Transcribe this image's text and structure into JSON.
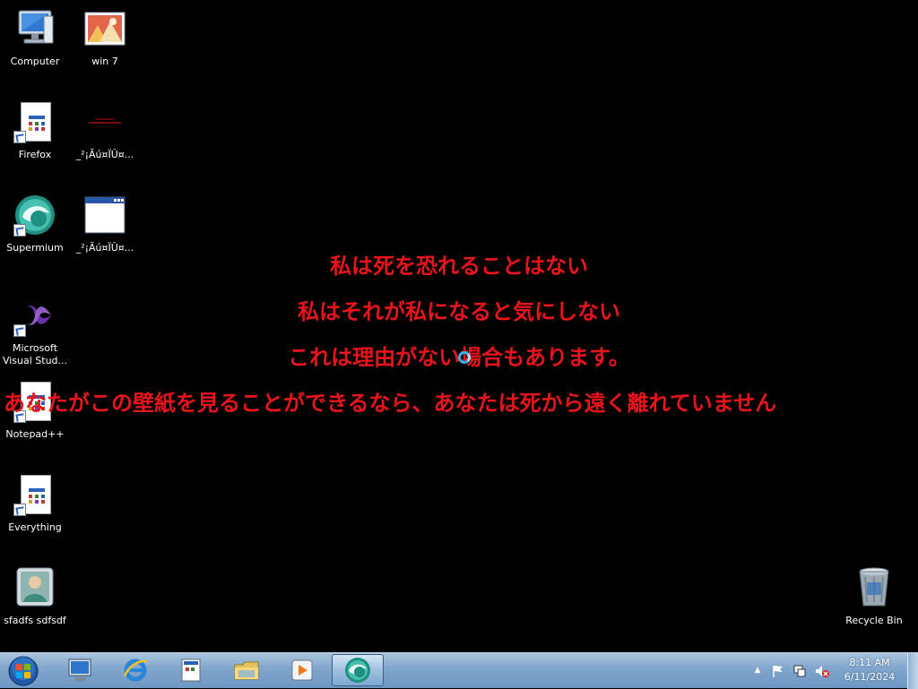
{
  "desktop": {
    "icons": [
      {
        "label": "Computer"
      },
      {
        "label": "win 7"
      },
      {
        "label": "Firefox"
      },
      {
        "label": "_²¡Ãú¤ÏÛ¤..."
      },
      {
        "label": "Supermium"
      },
      {
        "label": "_²¡Ãú¤ÏÛ¤..."
      },
      {
        "label": "Microsoft\nVisual Stud..."
      },
      {
        "label": "Notepad++"
      },
      {
        "label": "Everything"
      },
      {
        "label": "sfadfs sdfsdf"
      },
      {
        "label": "Recycle Bin"
      }
    ]
  },
  "wallpaper": {
    "lines": [
      "私は死を恐れることはない",
      "私はそれが私になると気にしない",
      "これは理由がない場合もあります。",
      "あなたがこの壁紙を見ることができるなら、あなたは死から遠く離れていません"
    ],
    "color": "#e8141b"
  },
  "taskbar": {
    "start": {
      "icon": "windows-orb-icon"
    },
    "pinned": [
      {
        "name": "computer-management-icon"
      },
      {
        "name": "internet-explorer-icon"
      },
      {
        "name": "application-icon"
      },
      {
        "name": "file-explorer-icon"
      },
      {
        "name": "media-player-icon"
      },
      {
        "name": "supermium-icon"
      }
    ],
    "tray": {
      "time": "8:11 AM",
      "date": "6/11/2024"
    }
  }
}
